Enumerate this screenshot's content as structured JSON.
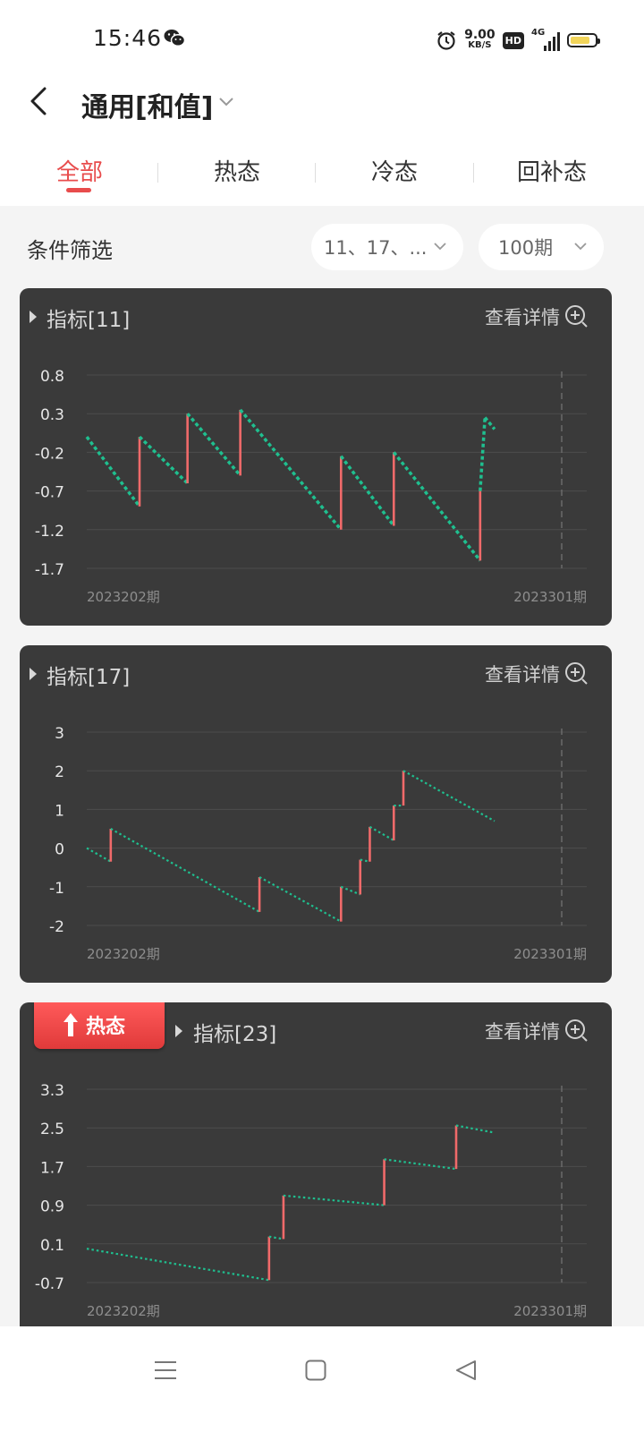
{
  "status_bar": {
    "time": "15:46",
    "net_speed_value": "9.00",
    "net_speed_unit": "KB/S",
    "hd_badge": "HD",
    "signal_label": "4G"
  },
  "header": {
    "title": "通用[和值]"
  },
  "tabs": [
    {
      "label": "全部",
      "active": true
    },
    {
      "label": "热态",
      "active": false
    },
    {
      "label": "冷态",
      "active": false
    },
    {
      "label": "回补态",
      "active": false
    }
  ],
  "filter": {
    "label": "条件筛选",
    "numbers_value": "11、17、...",
    "period_value": "100期"
  },
  "colors": {
    "accent": "#e84c4c",
    "rise": "#f06a6a",
    "fall": "#1fbf8f",
    "card_bg": "#3a3a3a"
  },
  "cards": [
    {
      "title": "指标[11]",
      "detail_label": "查看详情",
      "badge": ""
    },
    {
      "title": "指标[17]",
      "detail_label": "查看详情",
      "badge": ""
    },
    {
      "title": "指标[23]",
      "detail_label": "查看详情",
      "badge": "热态"
    }
  ],
  "chart_data": [
    {
      "type": "line",
      "title": "指标[11]",
      "x_start_label": "2023202期",
      "x_end_label": "2023301期",
      "y_ticks": [
        "0.8",
        "0.3",
        "-0.2",
        "-0.7",
        "-1.2",
        "-1.7"
      ],
      "ylim": [
        -1.7,
        0.8
      ],
      "grid": true,
      "n": 100,
      "points": [
        [
          0,
          0.0
        ],
        [
          11,
          -0.9
        ],
        [
          11,
          0.0
        ],
        [
          21,
          -0.6
        ],
        [
          21,
          0.3
        ],
        [
          32,
          -0.5
        ],
        [
          32,
          0.35
        ],
        [
          53,
          -1.2
        ],
        [
          53,
          -0.25
        ],
        [
          64,
          -1.15
        ],
        [
          64,
          -0.2
        ],
        [
          82,
          -1.6
        ],
        [
          82,
          -0.7
        ],
        [
          83,
          0.25
        ],
        [
          85,
          0.1
        ]
      ]
    },
    {
      "type": "line",
      "title": "指标[17]",
      "x_start_label": "2023202期",
      "x_end_label": "2023301期",
      "y_ticks": [
        "3",
        "2",
        "1",
        "0",
        "-1",
        "-2"
      ],
      "ylim": [
        -2,
        3
      ],
      "grid": true,
      "n": 100,
      "points": [
        [
          0,
          0.0
        ],
        [
          5,
          -0.35
        ],
        [
          5,
          0.5
        ],
        [
          36,
          -1.65
        ],
        [
          36,
          -0.75
        ],
        [
          53,
          -1.9
        ],
        [
          53,
          -1.0
        ],
        [
          57,
          -1.2
        ],
        [
          57,
          -0.3
        ],
        [
          59,
          -0.35
        ],
        [
          59,
          0.55
        ],
        [
          64,
          0.2
        ],
        [
          64,
          1.1
        ],
        [
          66,
          1.1
        ],
        [
          66,
          2.0
        ],
        [
          85,
          0.7
        ]
      ]
    },
    {
      "type": "line",
      "title": "指标[23]",
      "x_start_label": "2023202期",
      "x_end_label": "2023301期",
      "y_ticks": [
        "3.3",
        "2.5",
        "1.7",
        "0.9",
        "0.1",
        "-0.7"
      ],
      "ylim": [
        -0.7,
        3.3
      ],
      "grid": true,
      "n": 100,
      "points": [
        [
          0,
          0.0
        ],
        [
          38,
          -0.65
        ],
        [
          38,
          0.25
        ],
        [
          41,
          0.2
        ],
        [
          41,
          1.1
        ],
        [
          62,
          0.9
        ],
        [
          62,
          1.85
        ],
        [
          77,
          1.65
        ],
        [
          77,
          2.55
        ],
        [
          85,
          2.4
        ]
      ]
    }
  ]
}
